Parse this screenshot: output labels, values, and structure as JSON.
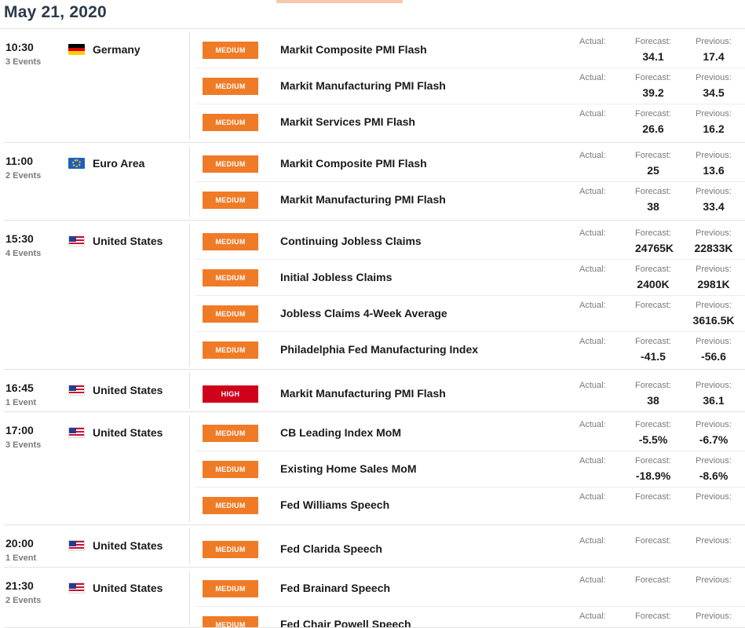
{
  "page": {
    "date": "May 21, 2020"
  },
  "labels": {
    "actual": "Actual:",
    "forecast": "Forecast:",
    "previous": "Previous:"
  },
  "groups": [
    {
      "time": "10:30",
      "count": "3 Events",
      "country": "Germany",
      "flag": "germany-flag-icon",
      "events": [
        {
          "impact": "MEDIUM",
          "name": "Markit Composite PMI Flash",
          "forecast": "34.1",
          "previous": "17.4"
        },
        {
          "impact": "MEDIUM",
          "name": "Markit Manufacturing PMI Flash",
          "forecast": "39.2",
          "previous": "34.5"
        },
        {
          "impact": "MEDIUM",
          "name": "Markit Services PMI Flash",
          "forecast": "26.6",
          "previous": "16.2"
        }
      ]
    },
    {
      "time": "11:00",
      "count": "2 Events",
      "country": "Euro Area",
      "flag": "euro-area-flag-icon",
      "events": [
        {
          "impact": "MEDIUM",
          "name": "Markit Composite PMI Flash",
          "forecast": "25",
          "previous": "13.6"
        },
        {
          "impact": "MEDIUM",
          "name": "Markit Manufacturing PMI Flash",
          "forecast": "38",
          "previous": "33.4"
        }
      ]
    },
    {
      "time": "15:30",
      "count": "4 Events",
      "country": "United States",
      "flag": "us-flag-icon",
      "events": [
        {
          "impact": "MEDIUM",
          "name": "Continuing Jobless Claims",
          "forecast": "24765K",
          "previous": "22833K"
        },
        {
          "impact": "MEDIUM",
          "name": "Initial Jobless Claims",
          "forecast": "2400K",
          "previous": "2981K"
        },
        {
          "impact": "MEDIUM",
          "name": "Jobless Claims 4-Week Average",
          "forecast": "",
          "previous": "3616.5K"
        },
        {
          "impact": "MEDIUM",
          "name": "Philadelphia Fed Manufacturing Index",
          "forecast": "-41.5",
          "previous": "-56.6"
        }
      ]
    },
    {
      "time": "16:45",
      "count": "1 Event",
      "country": "United States",
      "flag": "us-flag-icon",
      "events": [
        {
          "impact": "HIGH",
          "name": "Markit Manufacturing PMI Flash",
          "forecast": "38",
          "previous": "36.1"
        }
      ]
    },
    {
      "time": "17:00",
      "count": "3 Events",
      "country": "United States",
      "flag": "us-flag-icon",
      "events": [
        {
          "impact": "MEDIUM",
          "name": "CB Leading Index MoM",
          "forecast": "-5.5%",
          "previous": "-6.7%"
        },
        {
          "impact": "MEDIUM",
          "name": "Existing Home Sales MoM",
          "forecast": "-18.9%",
          "previous": "-8.6%"
        },
        {
          "impact": "MEDIUM",
          "name": "Fed Williams Speech",
          "forecast": "",
          "previous": ""
        }
      ]
    },
    {
      "time": "20:00",
      "count": "1 Event",
      "country": "United States",
      "flag": "us-flag-icon",
      "events": [
        {
          "impact": "MEDIUM",
          "name": "Fed Clarida Speech",
          "forecast": "",
          "previous": ""
        }
      ]
    },
    {
      "time": "21:30",
      "count": "2 Events",
      "country": "United States",
      "flag": "us-flag-icon",
      "events": [
        {
          "impact": "MEDIUM",
          "name": "Fed Brainard Speech",
          "forecast": "",
          "previous": ""
        },
        {
          "impact": "MEDIUM",
          "name": "Fed Chair Powell Speech",
          "forecast": "",
          "previous": ""
        }
      ]
    }
  ],
  "colors": {
    "medium": "#f07b27",
    "high": "#d0021b",
    "title": "#2b3a4a"
  }
}
